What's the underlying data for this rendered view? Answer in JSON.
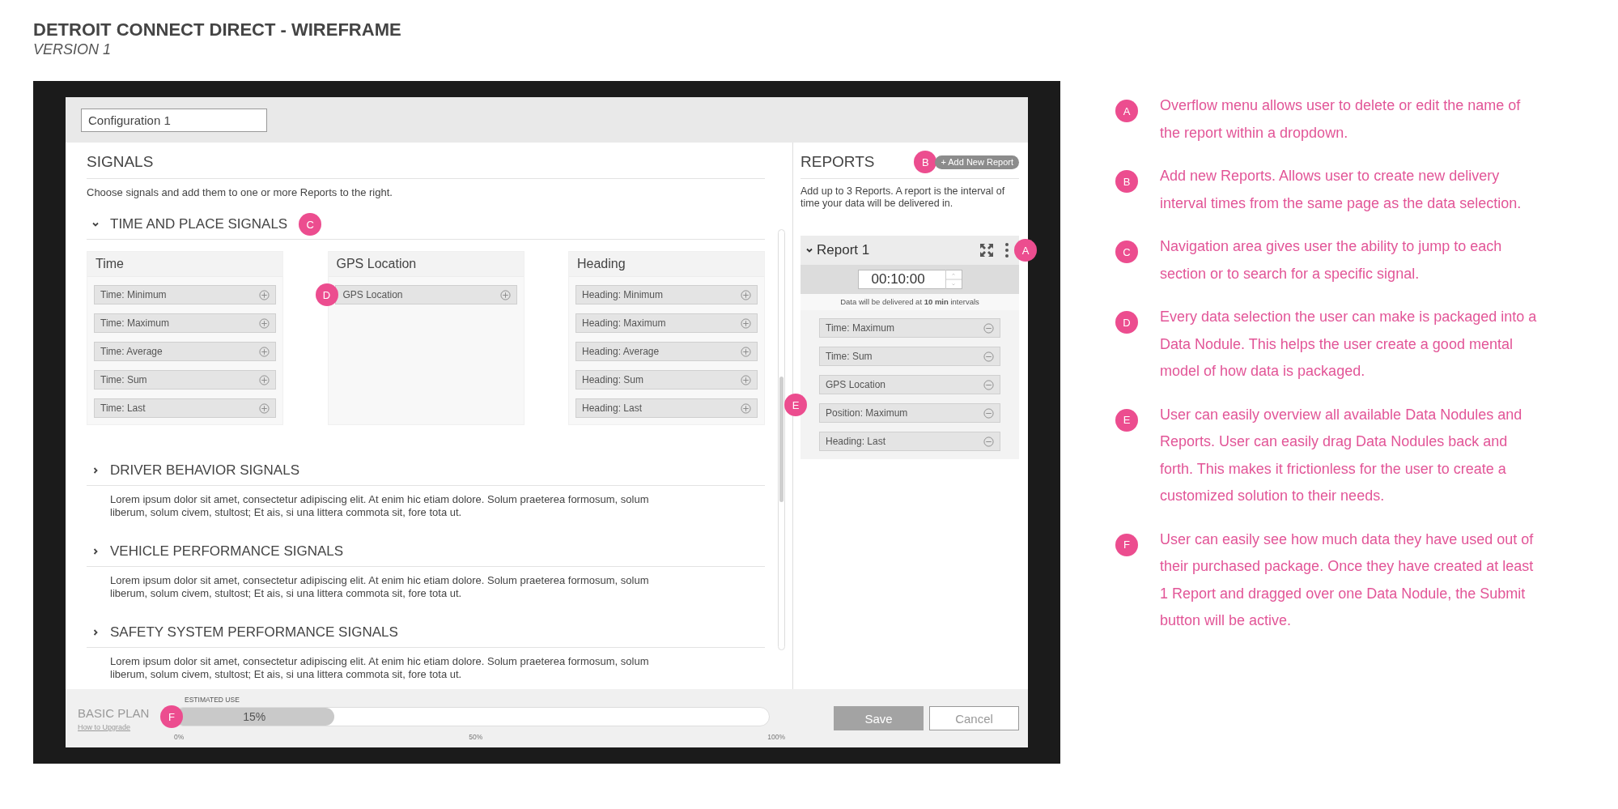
{
  "title": "DETROIT CONNECT DIRECT - WIREFRAME",
  "subtitle": "VERSION 1",
  "config_field": {
    "value": "Configuration 1"
  },
  "signals": {
    "heading": "SIGNALS",
    "description": "Choose signals and add them to one or more Reports to the right.",
    "sections": [
      {
        "title": "TIME AND PLACE SIGNALS",
        "expanded": true,
        "marker": "C",
        "groups": [
          {
            "title": "Time",
            "items": [
              {
                "label": "Time: Minimum"
              },
              {
                "label": "Time: Maximum"
              },
              {
                "label": "Time: Average"
              },
              {
                "label": "Time: Sum"
              },
              {
                "label": "Time: Last"
              }
            ]
          },
          {
            "title": "GPS Location",
            "items": [
              {
                "label": "GPS Location",
                "marker": "D"
              }
            ]
          },
          {
            "title": "Heading",
            "items": [
              {
                "label": "Heading: Minimum"
              },
              {
                "label": "Heading: Maximum"
              },
              {
                "label": "Heading: Average"
              },
              {
                "label": "Heading: Sum"
              },
              {
                "label": "Heading: Last"
              }
            ]
          }
        ]
      },
      {
        "title": "DRIVER BEHAVIOR SIGNALS",
        "expanded": false,
        "description": "Lorem ipsum dolor sit amet, consectetur adipiscing elit. At enim hic etiam dolore. Solum praeterea formosum, solum liberum, solum civem, stultost; Et ais, si una littera commota sit, fore tota ut."
      },
      {
        "title": "VEHICLE PERFORMANCE SIGNALS",
        "expanded": false,
        "description": "Lorem ipsum dolor sit amet, consectetur adipiscing elit. At enim hic etiam dolore. Solum praeterea formosum, solum liberum, solum civem, stultost; Et ais, si una littera commota sit, fore tota ut."
      },
      {
        "title": "SAFETY SYSTEM PERFORMANCE SIGNALS",
        "expanded": false,
        "description": "Lorem ipsum dolor sit amet, consectetur adipiscing elit. At enim hic etiam dolore. Solum praeterea formosum, solum liberum, solum civem, stultost; Et ais, si una littera commota sit, fore tota ut."
      }
    ]
  },
  "reports": {
    "heading": "REPORTS",
    "add_button": {
      "label": "+ Add New Report",
      "marker": "B"
    },
    "description": "Add up to 3 Reports. A report is the interval of time your data will be delivered in.",
    "list_marker": "E",
    "report": {
      "title": "Report 1",
      "expanded": true,
      "menu_marker": "A",
      "interval": "00:10:00",
      "note": "Data will be delivered at **10 min** intervals",
      "items": [
        {
          "label": "Time: Maximum"
        },
        {
          "label": "Time: Sum"
        },
        {
          "label": "GPS Location"
        },
        {
          "label": "Position: Maximum"
        },
        {
          "label": "Heading: Last"
        }
      ]
    }
  },
  "footer": {
    "plan": "BASIC PLAN",
    "upgrade_link": "How to Upgrade",
    "usage": {
      "caption": "ESTIMATED USE",
      "marker": "F",
      "reading": "15%",
      "level": 0.27,
      "ticks": [
        "0%",
        "50%",
        "100%"
      ]
    },
    "buttons": [
      {
        "label": "Save",
        "disabled": true
      },
      {
        "label": "Cancel",
        "disabled": false
      }
    ]
  },
  "annotations": [
    {
      "letter": "A",
      "text": "Overflow menu allows user to delete or edit the name of the report within a dropdown."
    },
    {
      "letter": "B",
      "text": "Add new Reports. Allows user to create new delivery interval times from the same page as the data selection."
    },
    {
      "letter": "C",
      "text": "Navigation area gives user the ability to jump to each section or to search for a specific signal."
    },
    {
      "letter": "D",
      "text": "Every data selection the user can make is packaged into a Data Nodule. This helps the user create a good mental model of how data is packaged."
    },
    {
      "letter": "E",
      "text": "User can easily overview all available Data Nodules and Reports. User can easily drag Data Nodules back and forth. This makes it frictionless for the user to create a customized solution to their needs."
    },
    {
      "letter": "F",
      "text": "User can easily see how much data they have used out of their purchased package. Once they have created at least 1 Report and dragged over one Data Nodule, the Submit button will be active."
    }
  ]
}
